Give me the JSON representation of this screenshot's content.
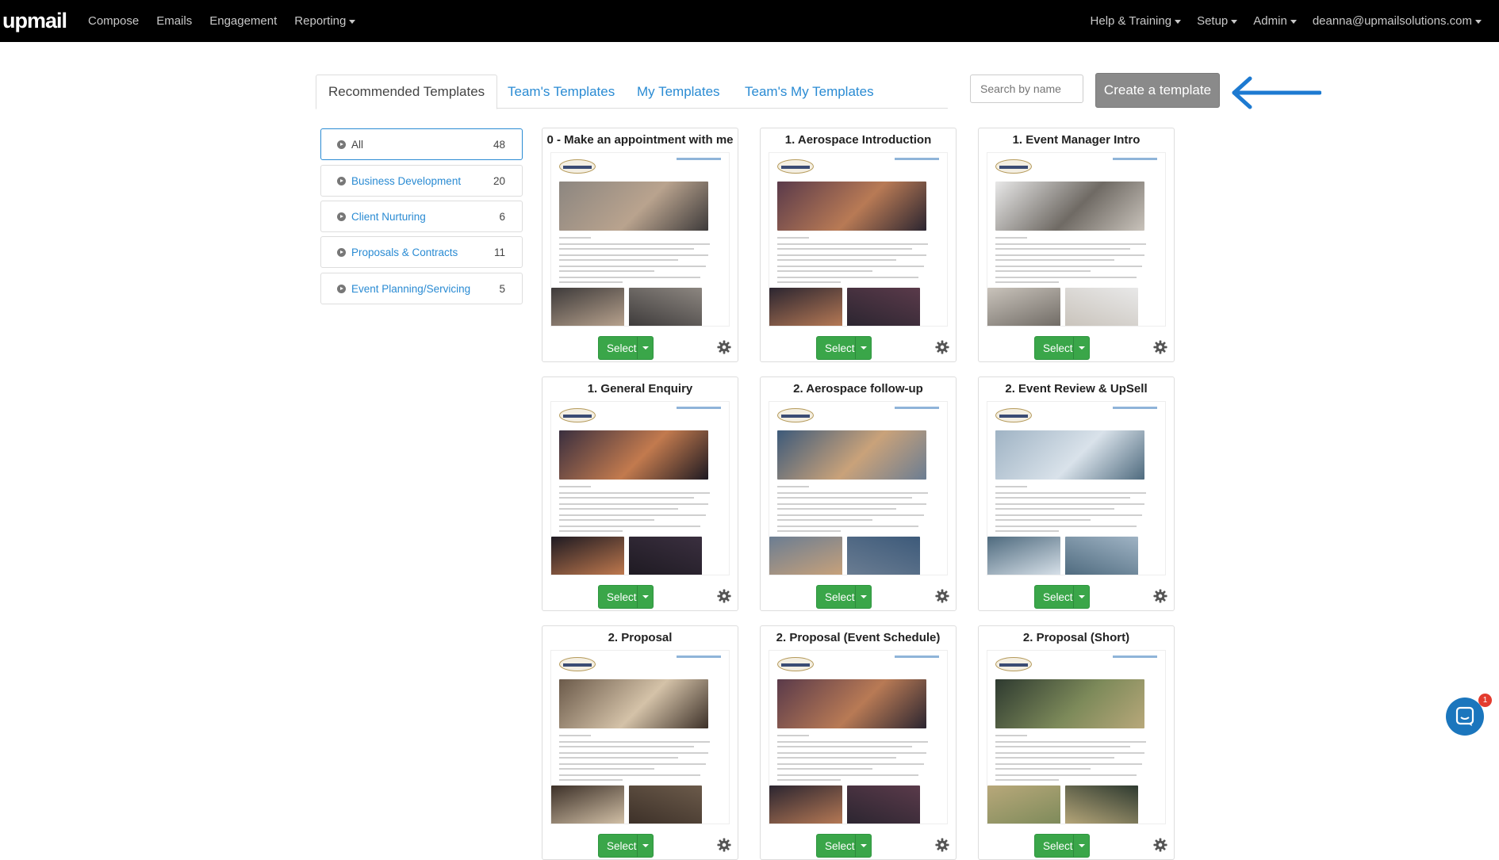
{
  "nav": {
    "logo": "upmail",
    "left_items": [
      "Compose",
      "Emails",
      "Engagement",
      "Reporting"
    ],
    "right_items": [
      "Help & Training",
      "Setup",
      "Admin",
      "deanna@upmailsolutions.com"
    ]
  },
  "tabs": [
    "Recommended Templates",
    "Team's Templates",
    "My Templates",
    "Team's My Templates"
  ],
  "search": {
    "placeholder": "Search by name"
  },
  "create_button": "Create a template",
  "categories": [
    {
      "label": "All",
      "count": "48"
    },
    {
      "label": "Business Development",
      "count": "20"
    },
    {
      "label": "Client Nurturing",
      "count": "6"
    },
    {
      "label": "Proposals & Contracts",
      "count": "11"
    },
    {
      "label": "Event Planning/Servicing",
      "count": "5"
    }
  ],
  "templates": [
    {
      "title": "0 - Make an appointment with me"
    },
    {
      "title": "1. Aerospace Introduction"
    },
    {
      "title": "1. Event Manager Intro"
    },
    {
      "title": "1. General Enquiry"
    },
    {
      "title": "2. Aerospace follow-up"
    },
    {
      "title": "2. Event Review & UpSell"
    },
    {
      "title": "2. Proposal"
    },
    {
      "title": "2. Proposal (Event Schedule)"
    },
    {
      "title": "2. Proposal (Short)"
    }
  ],
  "select_label": "Select",
  "chat_badge": "1",
  "colors": {
    "accent": "#2a8bd3",
    "select_green": "#3aa649",
    "create_gray": "#8a8a8a",
    "arrow": "#1d7ad1"
  }
}
